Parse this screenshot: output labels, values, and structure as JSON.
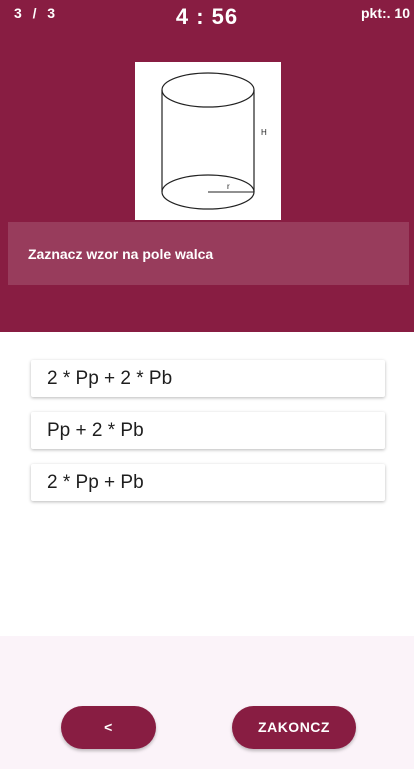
{
  "header": {
    "counter": "3  /  3",
    "timer": "4 : 56",
    "points": "pkt:. 10"
  },
  "figure": {
    "label_height": "H",
    "label_radius": "r"
  },
  "question": {
    "text": "Zaznacz wzor na pole walca"
  },
  "answers": [
    {
      "label": "2 * Pp + 2 * Pb"
    },
    {
      "label": "Pp + 2 * Pb"
    },
    {
      "label": "2 * Pp + Pb"
    }
  ],
  "buttons": {
    "back_label": "<",
    "finish_label": "ZAKONCZ"
  },
  "colors": {
    "primary": "#881d42",
    "bottom_background": "#fbf3f9"
  }
}
